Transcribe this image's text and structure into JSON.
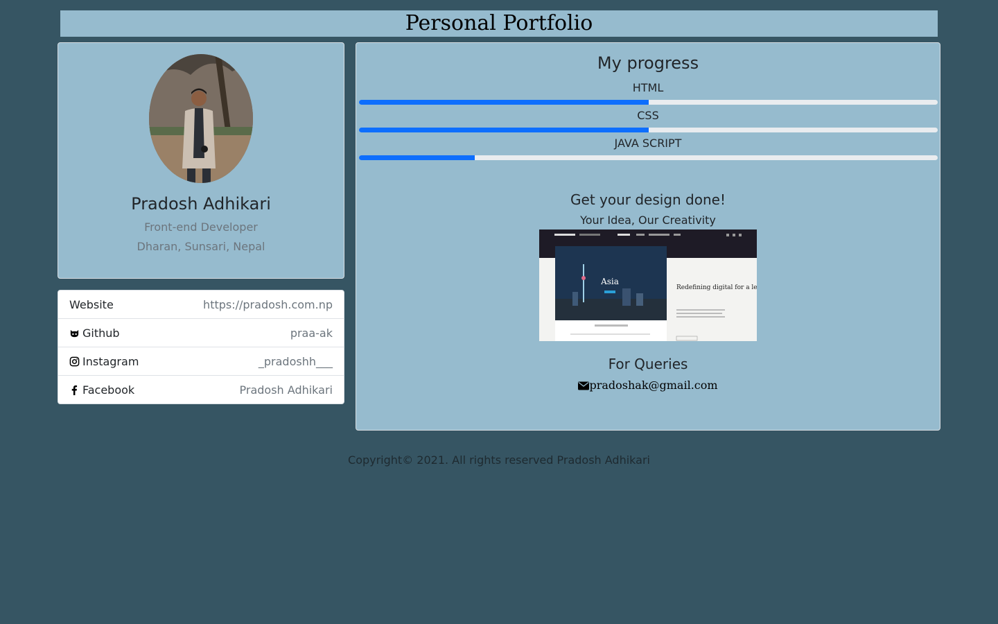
{
  "header": {
    "title": "Personal Portfolio"
  },
  "profile": {
    "name": "Pradosh Adhikari",
    "role": "Front-end Developer",
    "location": "Dharan, Sunsari, Nepal"
  },
  "social": [
    {
      "label": "Website",
      "value": "https://pradosh.com.np",
      "icon": "none"
    },
    {
      "label": "Github",
      "value": "praa-ak",
      "icon": "github-icon"
    },
    {
      "label": " Instagram",
      "value": "_pradoshh___",
      "icon": "instagram-icon"
    },
    {
      "label": " Facebook",
      "value": "Pradosh Adhikari",
      "icon": "facebook-icon"
    }
  ],
  "progress": {
    "title": "My progress",
    "skills": [
      {
        "label": "HTML",
        "percent": 50
      },
      {
        "label": "CSS",
        "percent": 50
      },
      {
        "label": "JAVA SCRIPT",
        "percent": 20
      }
    ]
  },
  "design": {
    "title": "Get your design done!",
    "subtitle": "Your Idea, Our Creativity",
    "image_text": {
      "hero": "Asia",
      "tagline": "Redefining digital for a legendary travel brand"
    }
  },
  "queries": {
    "title": "For Queries",
    "email": "pradoshak@gmail.com"
  },
  "footer": {
    "text": "Copyright© 2021. All rights reserved Pradosh Adhikari"
  },
  "colors": {
    "background": "#365563",
    "card": "#96bbce",
    "progress_fill": "#0d6efd",
    "progress_track": "#e9ecef"
  }
}
